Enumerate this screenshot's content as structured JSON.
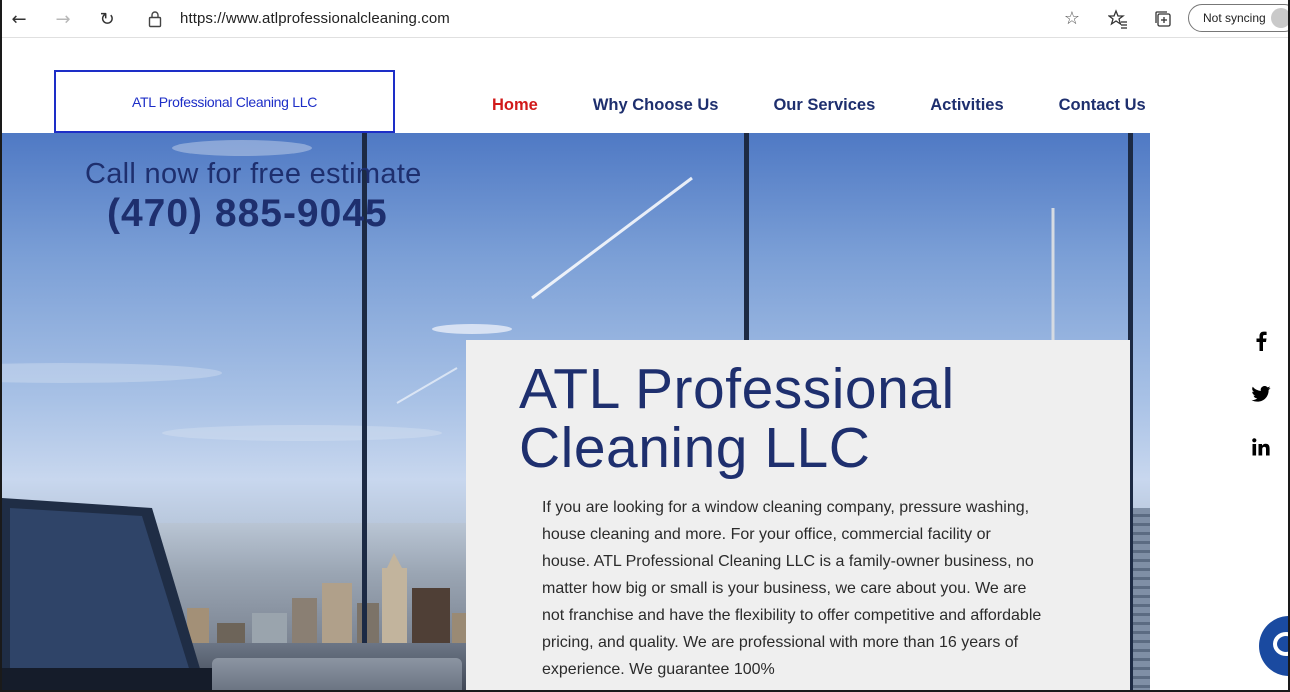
{
  "browser": {
    "url": "https://www.atlprofessionalcleaning.com",
    "sync_label": "Not syncing",
    "icons": [
      "back-arrow-icon",
      "forward-arrow-icon",
      "refresh-icon",
      "lock-icon",
      "star-icon",
      "favorites-icon",
      "collections-icon",
      "profile-icon"
    ]
  },
  "site": {
    "logo_text": "ATL Professional Cleaning LLC",
    "nav": [
      {
        "label": "Home",
        "active": true
      },
      {
        "label": "Why Choose Us",
        "active": false
      },
      {
        "label": "Our Services",
        "active": false
      },
      {
        "label": "Activities",
        "active": false
      },
      {
        "label": "Contact Us",
        "active": false
      }
    ],
    "hero": {
      "cta_line": "Call now for free estimate",
      "phone": "(470) 885-9045"
    },
    "card": {
      "title": "ATL Professional Cleaning LLC",
      "body": "If you are looking for a window cleaning company, pressure washing, house cleaning and more. For your office, commercial facility or house. ATL Professional Cleaning LLC is a family-owner business, no matter how big or small is your business, we care about you. We are not franchise and have the flexibility to offer competitive and affordable pricing, and quality. We are professional with more than 16 years of experience. We guarantee 100%"
    },
    "social": [
      "facebook-icon",
      "twitter-icon",
      "linkedin-icon"
    ],
    "colors": {
      "navy": "#1e2f6e",
      "active_red": "#d11a1a",
      "logo_blue": "#1d2ec7"
    }
  }
}
